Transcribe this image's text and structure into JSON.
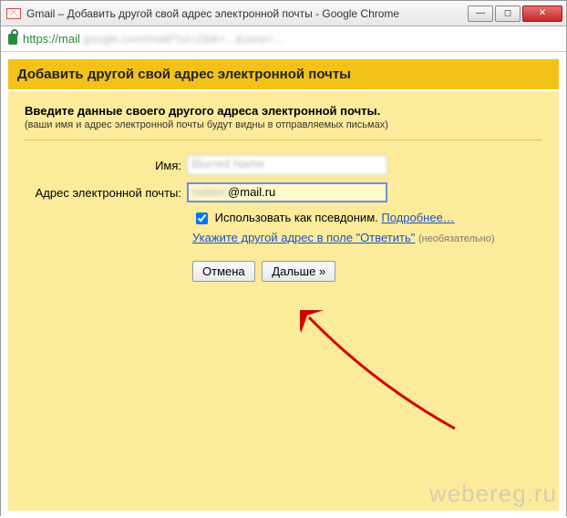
{
  "window": {
    "title": "Gmail – Добавить другой свой адрес электронной почты - Google Chrome"
  },
  "addressbar": {
    "https": "https://",
    "domain": "mail",
    "rest": ".google.com/mail/?ui=2&ik=...&view=..."
  },
  "header": {
    "title": "Добавить другой свой адрес электронной почты"
  },
  "intro": {
    "bold": "Введите данные своего другого адреса электронной почты.",
    "sub": "(ваши имя и адрес электронной почты будут видны в отправляемых письмах)"
  },
  "fields": {
    "name_label": "Имя:",
    "name_value": "Blurred Name",
    "email_label": "Адрес электронной почты:",
    "email_value_hidden": "hidden",
    "email_value_visible": "@mail.ru"
  },
  "options": {
    "alias_label": "Использовать как псевдоним.",
    "learn_more": "Подробнее…",
    "reply_link": "Укажите другой адрес в поле \"Ответить\"",
    "optional": "(необязательно)"
  },
  "buttons": {
    "cancel": "Отмена",
    "next": "Дальше »"
  },
  "watermark": "webereg.ru"
}
